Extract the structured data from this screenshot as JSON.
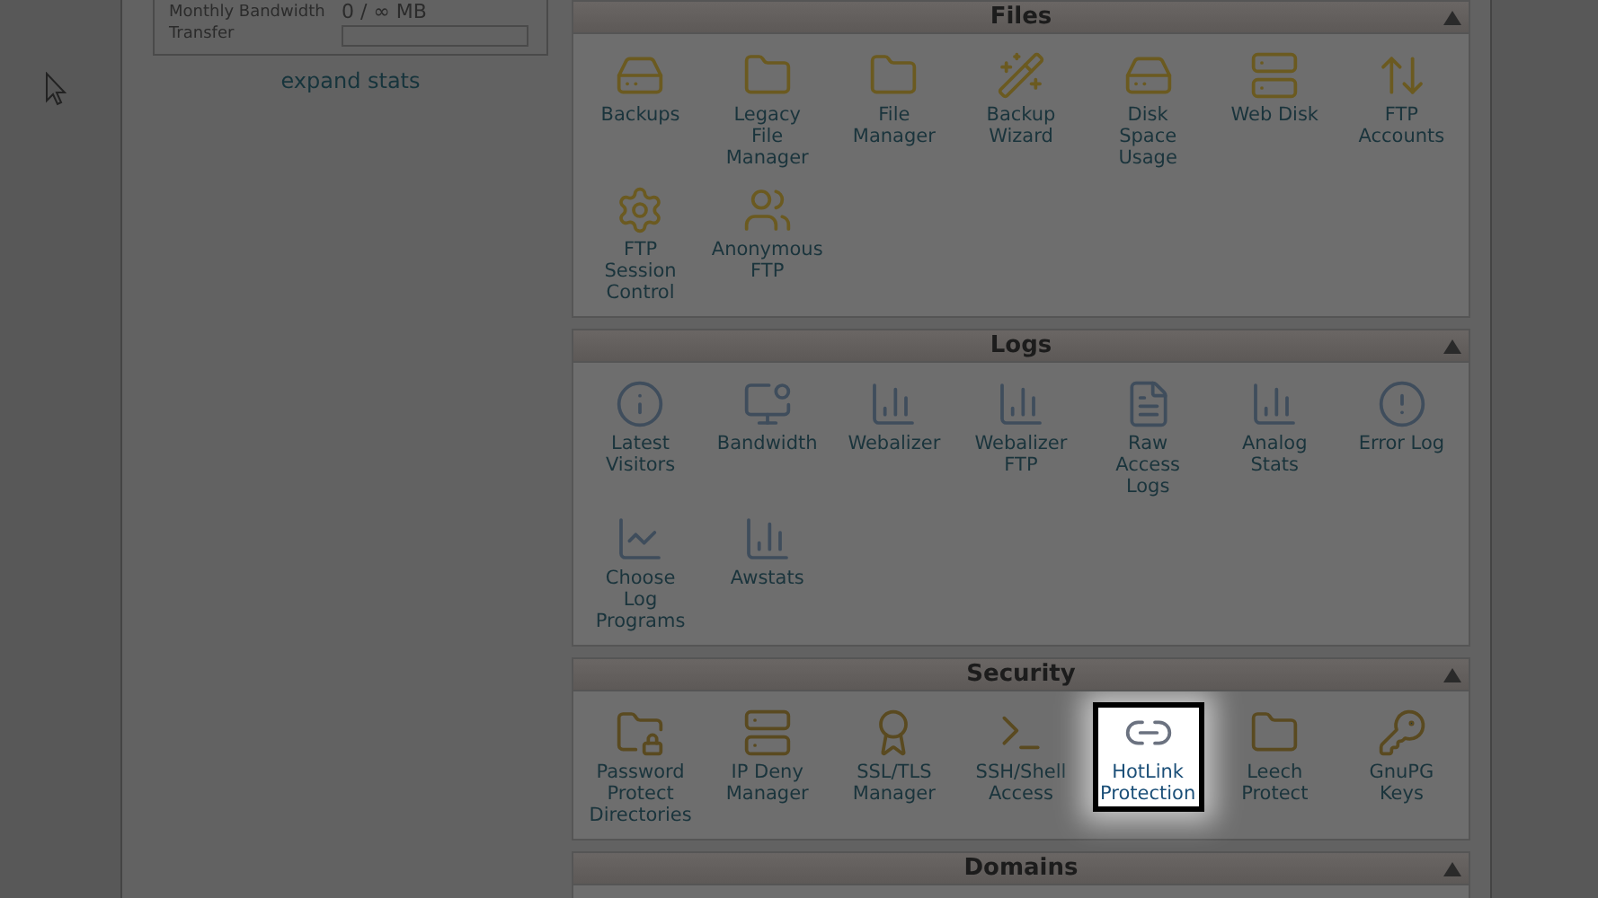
{
  "stats": {
    "label_1": "Monthly Bandwidth",
    "label_2": "Transfer",
    "value": "0 / ∞ MB",
    "level": 0,
    "link": "expand stats"
  },
  "sections": [
    {
      "title": "Files",
      "expanded": true,
      "items": [
        {
          "label": "Backups",
          "selected": false
        },
        {
          "label": "Legacy File Manager",
          "selected": false
        },
        {
          "label": "File Manager",
          "selected": false
        },
        {
          "label": "Backup Wizard",
          "selected": false
        },
        {
          "label": "Disk Space Usage",
          "selected": false
        },
        {
          "label": "Web Disk",
          "selected": false
        },
        {
          "label": "FTP Accounts",
          "selected": false
        },
        {
          "label": "FTP Session Control",
          "selected": false
        },
        {
          "label": "Anonymous FTP",
          "selected": false
        }
      ]
    },
    {
      "title": "Logs",
      "expanded": true,
      "items": [
        {
          "label": "Latest Visitors",
          "selected": false
        },
        {
          "label": "Bandwidth",
          "selected": false
        },
        {
          "label": "Webalizer",
          "selected": false
        },
        {
          "label": "Webalizer FTP",
          "selected": false
        },
        {
          "label": "Raw Access Logs",
          "selected": false
        },
        {
          "label": "Analog Stats",
          "selected": false
        },
        {
          "label": "Error Log",
          "selected": false
        },
        {
          "label": "Choose Log Programs",
          "selected": false
        },
        {
          "label": "Awstats",
          "selected": false
        }
      ]
    },
    {
      "title": "Security",
      "expanded": true,
      "items": [
        {
          "label": "Password Protect Directories",
          "selected": false
        },
        {
          "label": "IP Deny Manager",
          "selected": false
        },
        {
          "label": "SSL/TLS Manager",
          "selected": false
        },
        {
          "label": "SSH/Shell Access",
          "selected": false
        },
        {
          "label": "HotLink Protection",
          "selected": true
        },
        {
          "label": "Leech Protect",
          "selected": false
        },
        {
          "label": "GnuPG Keys",
          "selected": false
        }
      ]
    },
    {
      "title": "Domains",
      "expanded": true
    }
  ]
}
